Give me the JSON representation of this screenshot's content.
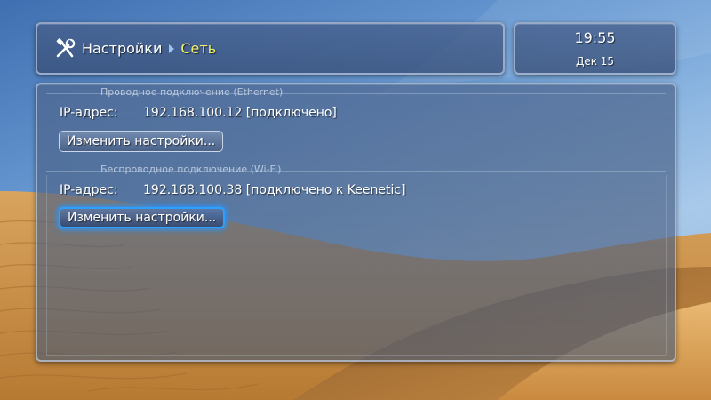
{
  "header": {
    "icon": "tools-icon",
    "root": "Настройки",
    "current": "Сеть"
  },
  "clock": {
    "time": "19:55",
    "date": "Дек 15"
  },
  "sections": [
    {
      "title": "Проводное подключение (Ethernet)",
      "ip_label": "IP-адрес:",
      "ip_value": "192.168.100.12 [подключено]",
      "button": "Изменить настройки..."
    },
    {
      "title": "Беспроводное подключение (Wi-Fi)",
      "ip_label": "IP-адрес:",
      "ip_value": "192.168.100.38 [подключено к Keenetic]",
      "button": "Изменить настройки..."
    }
  ],
  "colors": {
    "breadcrumb_current": "#f2ef6a",
    "focus_glow": "#2fa0ff"
  }
}
